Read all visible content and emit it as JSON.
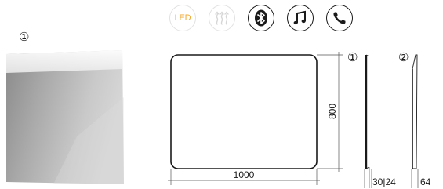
{
  "features": [
    {
      "name": "led",
      "icon": "led-icon",
      "label": "LED",
      "color": "#f0a830"
    },
    {
      "name": "heating",
      "icon": "heating-icon"
    },
    {
      "name": "bluetooth",
      "icon": "bluetooth-icon"
    },
    {
      "name": "music",
      "icon": "music-note-icon"
    },
    {
      "name": "phone",
      "icon": "phone-icon"
    }
  ],
  "markers": {
    "photo": "①",
    "side_a": "①",
    "side_b": "②"
  },
  "dimensions": {
    "width": "1000",
    "height": "800",
    "depth_a": "30|24",
    "depth_b": "64"
  }
}
